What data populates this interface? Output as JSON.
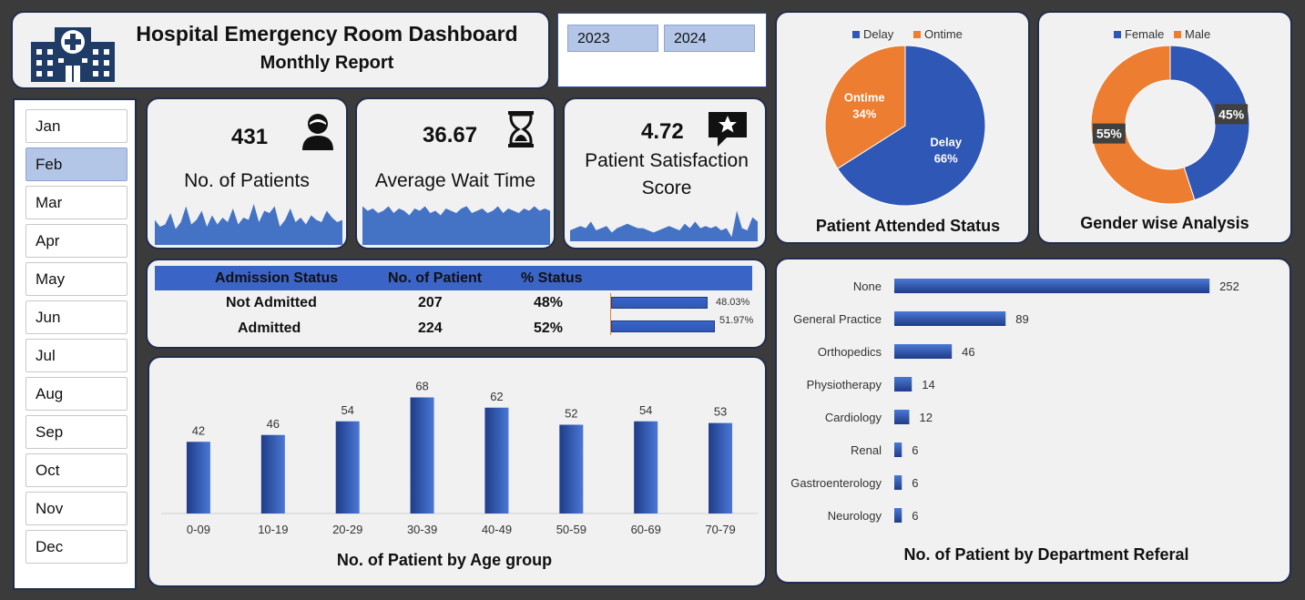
{
  "header": {
    "title": "Hospital Emergency Room Dashboard",
    "subtitle": "Monthly Report",
    "logo_icon": "hospital-building-icon"
  },
  "years": [
    "2023",
    "2024"
  ],
  "months": [
    "Jan",
    "Feb",
    "Mar",
    "Apr",
    "May",
    "Jun",
    "Jul",
    "Aug",
    "Sep",
    "Oct",
    "Nov",
    "Dec"
  ],
  "selected_month": "Feb",
  "kpis": {
    "patients": {
      "value": "431",
      "label": "No. of Patients",
      "icon": "patient-person-icon"
    },
    "wait_time": {
      "value": "36.67",
      "label": "Average Wait Time",
      "icon": "hourglass-icon"
    },
    "satisfaction": {
      "value": "4.72",
      "label": "Patient Satisfaction Score",
      "label_line1": "Patient Satisfaction",
      "label_line2": "Score",
      "icon": "star-speech-bubble-icon"
    }
  },
  "admission": {
    "headers": {
      "status": "Admission Status",
      "count": "No. of Patient",
      "pct": "% Status"
    },
    "rows": [
      {
        "status": "Not Admitted",
        "count": "207",
        "pct": "48%",
        "bar_label": "48.03%",
        "fraction": 0.4803
      },
      {
        "status": "Admitted",
        "count": "224",
        "pct": "52%",
        "bar_label": "51.97%",
        "fraction": 0.5197
      }
    ]
  },
  "colors": {
    "blue": "#2f57b5",
    "blue_dark": "#1f3c88",
    "orange": "#ed7d31",
    "panel": "#f1f1f1",
    "border": "#1f2d4d"
  },
  "chart_data": [
    {
      "type": "pie",
      "title": "Patient Attended Status",
      "legend": [
        "Delay",
        "Ontime"
      ],
      "legend_position": "top",
      "slices": [
        {
          "name": "Delay",
          "value": 66,
          "label": "66%"
        },
        {
          "name": "Ontime",
          "value": 34,
          "label": "34%"
        }
      ]
    },
    {
      "type": "pie",
      "subtype": "donut",
      "title": "Gender wise Analysis",
      "legend": [
        "Female",
        "Male"
      ],
      "legend_position": "top",
      "slices": [
        {
          "name": "Female",
          "value": 45,
          "label": "45%"
        },
        {
          "name": "Male",
          "value": 55,
          "label": "55%"
        }
      ]
    },
    {
      "type": "bar",
      "orientation": "vertical",
      "title": "No. of Patient by Age group",
      "categories": [
        "0-09",
        "10-19",
        "20-29",
        "30-39",
        "40-49",
        "50-59",
        "60-69",
        "70-79"
      ],
      "values": [
        42,
        46,
        54,
        68,
        62,
        52,
        54,
        53
      ],
      "ylim": [
        0,
        80
      ],
      "grid": false
    },
    {
      "type": "bar",
      "orientation": "horizontal",
      "title": "No. of Patient by Department Referal",
      "categories": [
        "None",
        "General Practice",
        "Orthopedics",
        "Physiotherapy",
        "Cardiology",
        "Renal",
        "Gastroenterology",
        "Neurology"
      ],
      "values": [
        252,
        89,
        46,
        14,
        12,
        6,
        6,
        6
      ],
      "xlim": [
        0,
        265
      ],
      "grid": false
    },
    {
      "type": "area",
      "name": "patients-sparkline",
      "values": [
        22,
        16,
        18,
        28,
        14,
        20,
        34,
        18,
        22,
        30,
        16,
        26,
        18,
        24,
        20,
        32,
        18,
        24,
        22,
        36,
        20,
        30,
        28,
        34,
        16,
        22,
        32,
        20,
        24,
        18,
        26,
        22,
        20,
        30,
        24,
        20,
        22
      ]
    },
    {
      "type": "area",
      "name": "wait-time-sparkline",
      "values": [
        34,
        30,
        32,
        28,
        30,
        34,
        28,
        32,
        30,
        26,
        32,
        30,
        34,
        28,
        30,
        26,
        32,
        30,
        28,
        32,
        34,
        28,
        30,
        32,
        28,
        30,
        34,
        28,
        32,
        30,
        28,
        32,
        30,
        34,
        30,
        32,
        30
      ]
    },
    {
      "type": "area",
      "name": "satisfaction-sparkline",
      "values": [
        10,
        12,
        14,
        12,
        18,
        10,
        12,
        14,
        8,
        12,
        14,
        16,
        14,
        12,
        12,
        10,
        8,
        10,
        12,
        14,
        12,
        10,
        16,
        12,
        18,
        12,
        14,
        12,
        14,
        10,
        12,
        4,
        28,
        12,
        10,
        22,
        18
      ]
    }
  ]
}
